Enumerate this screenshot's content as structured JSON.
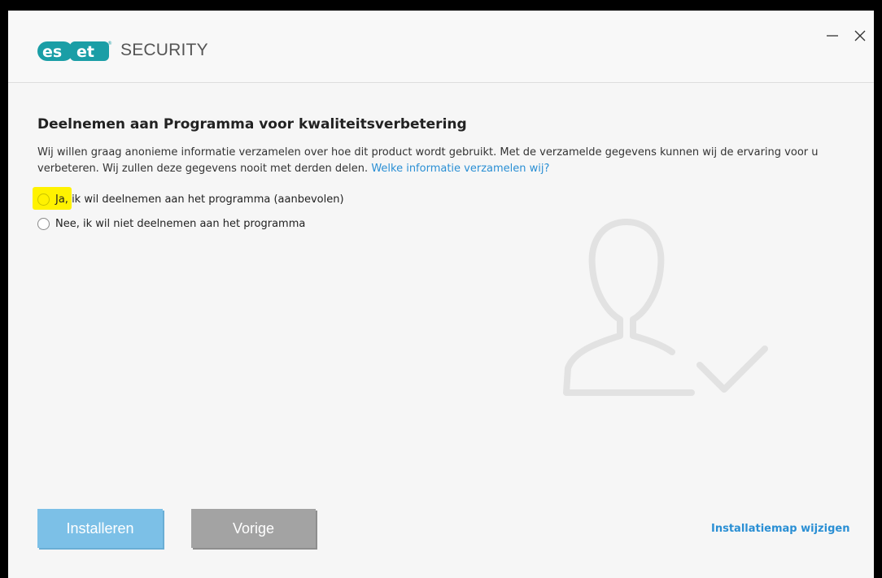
{
  "header": {
    "logo_text": "eset",
    "product": "SECURITY"
  },
  "window_controls": {
    "minimize": "minimize-icon",
    "close": "close-icon"
  },
  "main": {
    "title": "Deelnemen aan Programma voor kwaliteitsverbetering",
    "description": "Wij willen graag anonieme informatie verzamelen over hoe dit product wordt gebruikt. Met de verzamelde gegevens kunnen wij de ervaring voor u verbeteren. Wij zullen deze gegevens nooit met derden delen.",
    "info_link": "Welke informatie verzamelen wij?",
    "options": [
      {
        "label_highlight": "Ja,",
        "label": " ik wil deelnemen aan het programma (aanbevolen)",
        "selected": false,
        "highlighted": true
      },
      {
        "label": "Nee, ik wil niet deelnemen aan het programma",
        "selected": false
      }
    ]
  },
  "footer": {
    "install_label": "Installeren",
    "back_label": "Vorige",
    "change_dir_label": "Installatiemap wijzigen"
  },
  "colors": {
    "accent": "#2a8fd4",
    "install_button": "#7cc0e7",
    "back_button": "#a3a3a3",
    "highlight": "#fff200"
  }
}
